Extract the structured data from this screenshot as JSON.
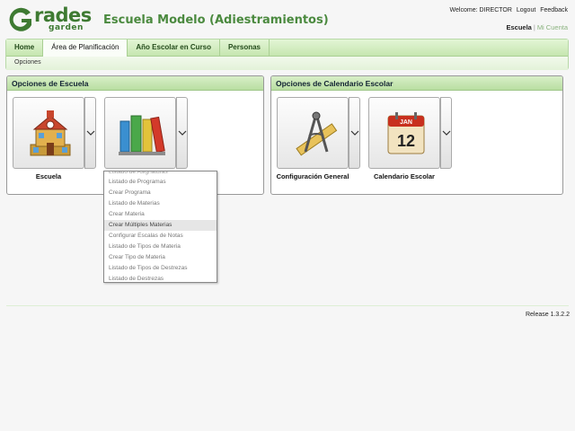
{
  "header": {
    "logo_text": "rades",
    "logo_sub": "garden",
    "school_name": "Escuela Modelo (Adiestramientos)",
    "welcome": "Welcome: DIRECTOR",
    "logout": "Logout",
    "feedback": "Feedback",
    "account_active": "Escuela",
    "account_separator": "|",
    "account_other": "Mi Cuenta"
  },
  "nav": {
    "tabs": [
      {
        "label": "Home"
      },
      {
        "label": "Área de Planificación"
      },
      {
        "label": "Año Escolar en Curso"
      },
      {
        "label": "Personas"
      }
    ],
    "subnav": "Opciones"
  },
  "panels": {
    "school": {
      "title": "Opciones de Escuela",
      "tiles": [
        {
          "label": "Escuela",
          "icon": "school-building-icon"
        },
        {
          "label": "",
          "icon": "books-icon"
        }
      ]
    },
    "calendar": {
      "title": "Opciones de Calendario Escolar",
      "tiles": [
        {
          "label": "Configuración General",
          "icon": "drafting-tools-icon"
        },
        {
          "label": "Calendario Escolar",
          "icon": "calendar-icon",
          "month": "JAN",
          "day": "12"
        }
      ]
    }
  },
  "dropdown": {
    "partial_item": "Listado de Asignaturas",
    "items": [
      "Listado de Programas",
      "Crear Programa",
      "Listado de Materias",
      "Crear Materia",
      "Crear Múltiples Materias",
      "Configurar Escalas de Notas",
      "Listado de Tipos de Materia",
      "Crear Tipo de Materia",
      "Listado de Tipos de Destrezas",
      "Listado de Destrezas"
    ],
    "hover_index": 4
  },
  "footer": {
    "release": "Release 1.3.2.2"
  },
  "colors": {
    "brand_green": "#3e7a32",
    "title_green": "#4b8a3f",
    "nav_green": "#c6e6b0"
  }
}
